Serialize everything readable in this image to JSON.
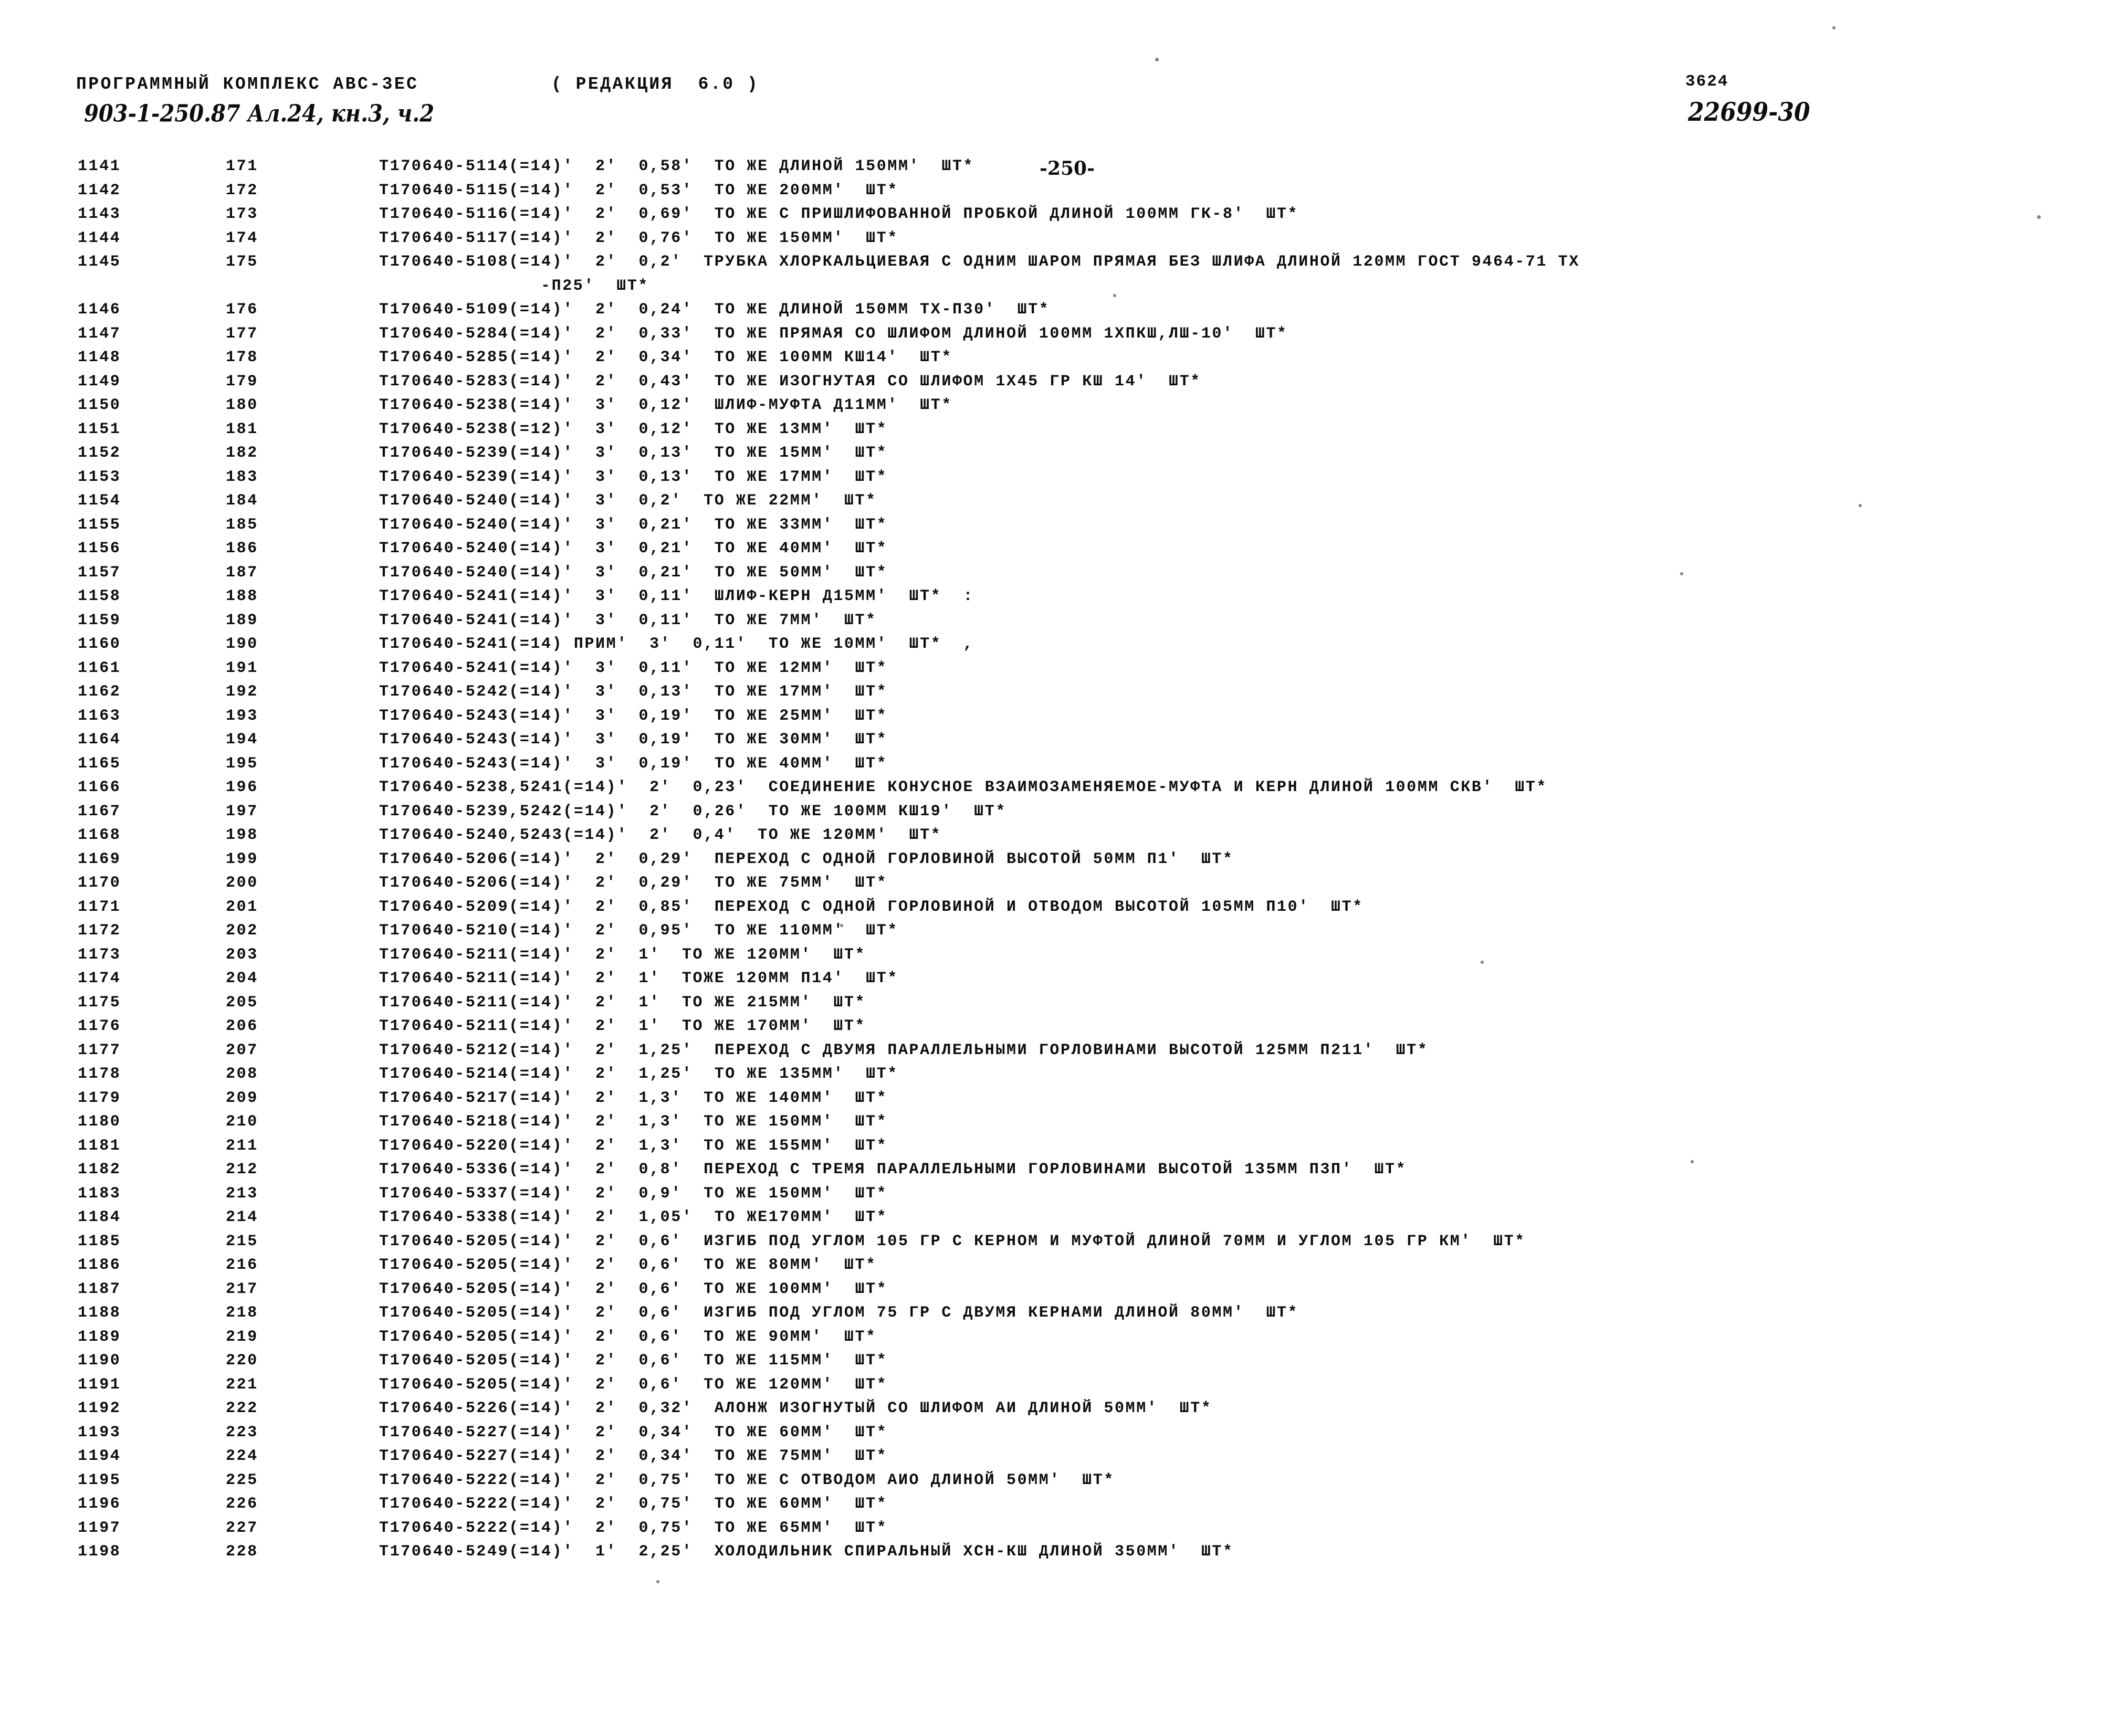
{
  "header": {
    "program_line": "ПРОГРАММНЫЙ КОМПЛЕКС АВС-3ЕС",
    "edition": "( РЕДАКЦИЯ  6.0 )",
    "document_mark": "903-1-250.87 Ал.24, кн.3, ч.2",
    "page_number": "-250-",
    "code_top": "3624",
    "code_handwritten": "22699-30"
  },
  "rows": [
    {
      "seq": "1141",
      "idx": "171",
      "body": "Т170640-5114(=14)'  2'  0,58'  ТО ЖЕ ДЛИНОЙ 150ММ'  ШТ*"
    },
    {
      "seq": "1142",
      "idx": "172",
      "body": "Т170640-5115(=14)'  2'  0,53'  ТО ЖЕ 200ММ'  ШТ*"
    },
    {
      "seq": "1143",
      "idx": "173",
      "body": "Т170640-5116(=14)'  2'  0,69'  ТО ЖЕ С ПРИШЛИФОВАННОЙ ПРОБКОЙ ДЛИНОЙ 100ММ ГК-8'  ШТ*"
    },
    {
      "seq": "1144",
      "idx": "174",
      "body": "Т170640-5117(=14)'  2'  0,76'  ТО ЖЕ 150ММ'  ШТ*"
    },
    {
      "seq": "1145",
      "idx": "175",
      "body": "Т170640-5108(=14)'  2'  0,2'  ТРУБКА ХЛОРКАЛЬЦИЕВАЯ С ОДНИМ ШАРОМ ПРЯМАЯ БЕЗ ШЛИФА ДЛИНОЙ 120ММ ГОСТ 9464-71 ТХ"
    },
    {
      "seq": "",
      "idx": "",
      "body": "-П25'  ШТ*",
      "continuation": true
    },
    {
      "seq": "1146",
      "idx": "176",
      "body": "Т170640-5109(=14)'  2'  0,24'  ТО ЖЕ ДЛИНОЙ 150ММ ТХ-П30'  ШТ*"
    },
    {
      "seq": "1147",
      "idx": "177",
      "body": "Т170640-5284(=14)'  2'  0,33'  ТО ЖЕ ПРЯМАЯ СО ШЛИФОМ ДЛИНОЙ 100ММ 1ХПКШ,ЛШ-10'  ШТ*"
    },
    {
      "seq": "1148",
      "idx": "178",
      "body": "Т170640-5285(=14)'  2'  0,34'  ТО ЖЕ 100ММ КШ14'  ШТ*"
    },
    {
      "seq": "1149",
      "idx": "179",
      "body": "Т170640-5283(=14)'  2'  0,43'  ТО ЖЕ ИЗОГНУТАЯ СО ШЛИФОМ 1Х45 ГР КШ 14'  ШТ*"
    },
    {
      "seq": "1150",
      "idx": "180",
      "body": "Т170640-5238(=14)'  3'  0,12'  ШЛИФ-МУФТА Д11ММ'  ШТ*"
    },
    {
      "seq": "1151",
      "idx": "181",
      "body": "Т170640-5238(=12)'  3'  0,12'  ТО ЖЕ 13ММ'  ШТ*"
    },
    {
      "seq": "1152",
      "idx": "182",
      "body": "Т170640-5239(=14)'  3'  0,13'  ТО ЖЕ 15ММ'  ШТ*"
    },
    {
      "seq": "1153",
      "idx": "183",
      "body": "Т170640-5239(=14)'  3'  0,13'  ТО ЖЕ 17ММ'  ШТ*"
    },
    {
      "seq": "1154",
      "idx": "184",
      "body": "Т170640-5240(=14)'  3'  0,2'  ТО ЖЕ 22ММ'  ШТ*"
    },
    {
      "seq": "1155",
      "idx": "185",
      "body": "Т170640-5240(=14)'  3'  0,21'  ТО ЖЕ 33ММ'  ШТ*"
    },
    {
      "seq": "1156",
      "idx": "186",
      "body": "Т170640-5240(=14)'  3'  0,21'  ТО ЖЕ 40ММ'  ШТ*"
    },
    {
      "seq": "1157",
      "idx": "187",
      "body": "Т170640-5240(=14)'  3'  0,21'  ТО ЖЕ 50ММ'  ШТ*"
    },
    {
      "seq": "1158",
      "idx": "188",
      "body": "Т170640-5241(=14)'  3'  0,11'  ШЛИФ-КЕРН Д15ММ'  ШТ*  :"
    },
    {
      "seq": "1159",
      "idx": "189",
      "body": "Т170640-5241(=14)'  3'  0,11'  ТО ЖЕ 7ММ'  ШТ*"
    },
    {
      "seq": "1160",
      "idx": "190",
      "body": "Т170640-5241(=14) ПРИМ'  3'  0,11'  ТО ЖЕ 10ММ'  ШТ*  ,"
    },
    {
      "seq": "1161",
      "idx": "191",
      "body": "Т170640-5241(=14)'  3'  0,11'  ТО ЖЕ 12ММ'  ШТ*"
    },
    {
      "seq": "1162",
      "idx": "192",
      "body": "Т170640-5242(=14)'  3'  0,13'  ТО ЖЕ 17ММ'  ШТ*"
    },
    {
      "seq": "1163",
      "idx": "193",
      "body": "Т170640-5243(=14)'  3'  0,19'  ТО ЖЕ 25ММ'  ШТ*"
    },
    {
      "seq": "1164",
      "idx": "194",
      "body": "Т170640-5243(=14)'  3'  0,19'  ТО ЖЕ 30ММ'  ШТ*"
    },
    {
      "seq": "1165",
      "idx": "195",
      "body": "Т170640-5243(=14)'  3'  0,19'  ТО ЖЕ 40ММ'  ШТ*"
    },
    {
      "seq": "1166",
      "idx": "196",
      "body": "Т170640-5238,5241(=14)'  2'  0,23'  СОЕДИНЕНИЕ КОНУСНОЕ ВЗАИМОЗАМЕНЯЕМОЕ-МУФТА И КЕРН ДЛИНОЙ 100ММ СКВ'  ШТ*"
    },
    {
      "seq": "1167",
      "idx": "197",
      "body": "Т170640-5239,5242(=14)'  2'  0,26'  ТО ЖЕ 100ММ КШ19'  ШТ*"
    },
    {
      "seq": "1168",
      "idx": "198",
      "body": "Т170640-5240,5243(=14)'  2'  0,4'  ТО ЖЕ 120ММ'  ШТ*"
    },
    {
      "seq": "1169",
      "idx": "199",
      "body": "Т170640-5206(=14)'  2'  0,29'  ПЕРЕХОД С ОДНОЙ ГОРЛОВИНОЙ ВЫСОТОЙ 50ММ П1'  ШТ*"
    },
    {
      "seq": "1170",
      "idx": "200",
      "body": "Т170640-5206(=14)'  2'  0,29'  ТО ЖЕ 75ММ'  ШТ*"
    },
    {
      "seq": "1171",
      "idx": "201",
      "body": "Т170640-5209(=14)'  2'  0,85'  ПЕРЕХОД С ОДНОЙ ГОРЛОВИНОЙ И ОТВОДОМ ВЫСОТОЙ 105ММ П10'  ШТ*"
    },
    {
      "seq": "1172",
      "idx": "202",
      "body": "Т170640-5210(=14)'  2'  0,95'  ТО ЖЕ 110ММ'  ШТ*"
    },
    {
      "seq": "1173",
      "idx": "203",
      "body": "Т170640-5211(=14)'  2'  1'  ТО ЖЕ 120ММ'  ШТ*"
    },
    {
      "seq": "1174",
      "idx": "204",
      "body": "Т170640-5211(=14)'  2'  1'  ТОЖЕ 120ММ П14'  ШТ*"
    },
    {
      "seq": "1175",
      "idx": "205",
      "body": "Т170640-5211(=14)'  2'  1'  ТО ЖЕ 215ММ'  ШТ*"
    },
    {
      "seq": "1176",
      "idx": "206",
      "body": "Т170640-5211(=14)'  2'  1'  ТО ЖЕ 170ММ'  ШТ*"
    },
    {
      "seq": "1177",
      "idx": "207",
      "body": "Т170640-5212(=14)'  2'  1,25'  ПЕРЕХОД С ДВУМЯ ПАРАЛЛЕЛЬНЫМИ ГОРЛОВИНАМИ ВЫСОТОЙ 125ММ П211'  ШТ*"
    },
    {
      "seq": "1178",
      "idx": "208",
      "body": "Т170640-5214(=14)'  2'  1,25'  ТО ЖЕ 135ММ'  ШТ*"
    },
    {
      "seq": "1179",
      "idx": "209",
      "body": "Т170640-5217(=14)'  2'  1,3'  ТО ЖЕ 140ММ'  ШТ*"
    },
    {
      "seq": "1180",
      "idx": "210",
      "body": "Т170640-5218(=14)'  2'  1,3'  ТО ЖЕ 150ММ'  ШТ*"
    },
    {
      "seq": "1181",
      "idx": "211",
      "body": "Т170640-5220(=14)'  2'  1,3'  ТО ЖЕ 155ММ'  ШТ*"
    },
    {
      "seq": "1182",
      "idx": "212",
      "body": "Т170640-5336(=14)'  2'  0,8'  ПЕРЕХОД С ТРЕМЯ ПАРАЛЛЕЛЬНЫМИ ГОРЛОВИНАМИ ВЫСОТОЙ 135ММ П3П'  ШТ*"
    },
    {
      "seq": "1183",
      "idx": "213",
      "body": "Т170640-5337(=14)'  2'  0,9'  ТО ЖЕ 150ММ'  ШТ*"
    },
    {
      "seq": "1184",
      "idx": "214",
      "body": "Т170640-5338(=14)'  2'  1,05'  ТО ЖЕ170ММ'  ШТ*"
    },
    {
      "seq": "1185",
      "idx": "215",
      "body": "Т170640-5205(=14)'  2'  0,6'  ИЗГИБ ПОД УГЛОМ 105 ГР С КЕРНОМ И МУФТОЙ ДЛИНОЙ 70ММ И УГЛОМ 105 ГР КМ'  ШТ*"
    },
    {
      "seq": "1186",
      "idx": "216",
      "body": "Т170640-5205(=14)'  2'  0,6'  ТО ЖЕ 80ММ'  ШТ*"
    },
    {
      "seq": "1187",
      "idx": "217",
      "body": "Т170640-5205(=14)'  2'  0,6'  ТО ЖЕ 100ММ'  ШТ*"
    },
    {
      "seq": "1188",
      "idx": "218",
      "body": "Т170640-5205(=14)'  2'  0,6'  ИЗГИБ ПОД УГЛОМ 75 ГР С ДВУМЯ КЕРНАМИ ДЛИНОЙ 80ММ'  ШТ*"
    },
    {
      "seq": "1189",
      "idx": "219",
      "body": "Т170640-5205(=14)'  2'  0,6'  ТО ЖЕ 90ММ'  ШТ*"
    },
    {
      "seq": "1190",
      "idx": "220",
      "body": "Т170640-5205(=14)'  2'  0,6'  ТО ЖЕ 115ММ'  ШТ*"
    },
    {
      "seq": "1191",
      "idx": "221",
      "body": "Т170640-5205(=14)'  2'  0,6'  ТО ЖЕ 120ММ'  ШТ*"
    },
    {
      "seq": "1192",
      "idx": "222",
      "body": "Т170640-5226(=14)'  2'  0,32'  АЛОНЖ ИЗОГНУТЫЙ СО ШЛИФОМ АИ ДЛИНОЙ 50ММ'  ШТ*"
    },
    {
      "seq": "1193",
      "idx": "223",
      "body": "Т170640-5227(=14)'  2'  0,34'  ТО ЖЕ 60ММ'  ШТ*"
    },
    {
      "seq": "1194",
      "idx": "224",
      "body": "Т170640-5227(=14)'  2'  0,34'  ТО ЖЕ 75ММ'  ШТ*"
    },
    {
      "seq": "1195",
      "idx": "225",
      "body": "Т170640-5222(=14)'  2'  0,75'  ТО ЖЕ С ОТВОДОМ АИО ДЛИНОЙ 50ММ'  ШТ*"
    },
    {
      "seq": "1196",
      "idx": "226",
      "body": "Т170640-5222(=14)'  2'  0,75'  ТО ЖЕ 60ММ'  ШТ*"
    },
    {
      "seq": "1197",
      "idx": "227",
      "body": "Т170640-5222(=14)'  2'  0,75'  ТО ЖЕ 65ММ'  ШТ*"
    },
    {
      "seq": "1198",
      "idx": "228",
      "body": "Т170640-5249(=14)'  1'  2,25'  ХОЛОДИЛЬНИК СПИРАЛЬНЫЙ ХСН-КШ ДЛИНОЙ 350ММ'  ШТ*"
    }
  ]
}
